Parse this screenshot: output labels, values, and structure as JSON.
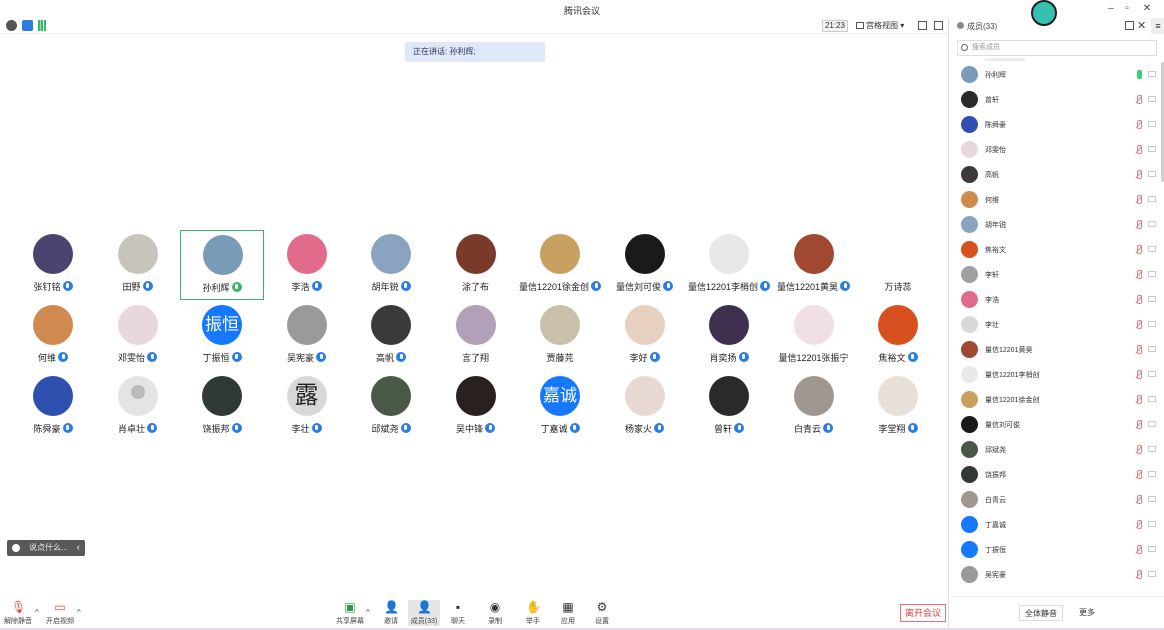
{
  "window": {
    "title": "腾讯会议"
  },
  "toolbar": {
    "clock": "21:23",
    "layout_label": "宫格视图",
    "layout_caret": "▾"
  },
  "speaking_banner": "正在讲话: 孙利辉;",
  "grid": [
    {
      "name": "张钉铭",
      "bg": "#4a4470",
      "mic": "blue"
    },
    {
      "name": "田野",
      "bg": "#c9c4bb",
      "mic": "blue"
    },
    {
      "name": "孙利辉",
      "bg": "#7a9bb8",
      "mic": "green",
      "active": true
    },
    {
      "name": "李浩",
      "bg": "#e06b8a",
      "mic": "blue"
    },
    {
      "name": "胡年锐",
      "bg": "#8aa4c0",
      "mic": "blue"
    },
    {
      "name": "涂了布",
      "bg": "#7a3a2a",
      "mic": "none"
    },
    {
      "name": "量信12201徐金创",
      "bg": "#c8a060",
      "mic": "blue"
    },
    {
      "name": "量信刘可俊",
      "bg": "#1a1a1a",
      "mic": "blue"
    },
    {
      "name": "量信12201李梢创",
      "bg": "#e8e8e8",
      "mic": "blue"
    },
    {
      "name": "量信12201黄昊",
      "bg": "#a04830",
      "mic": "blue"
    },
    {
      "name": "万诗蕊",
      "bg": "#ffffff",
      "mic": "none"
    },
    {
      "name": "何维",
      "bg": "#d08a50",
      "mic": "blue"
    },
    {
      "name": "邓雯怡",
      "bg": "#e8d8dc",
      "mic": "blue"
    },
    {
      "name": "丁振恒",
      "bg": "#1677ff",
      "text": "振恒",
      "mic": "blue"
    },
    {
      "name": "吴宪豪",
      "bg": "#9a9a9a",
      "mic": "blue"
    },
    {
      "name": "高帆",
      "bg": "#3a3a3a",
      "mic": "blue"
    },
    {
      "name": "言了翔",
      "bg": "#b0a0b8",
      "mic": "none"
    },
    {
      "name": "贾藤芫",
      "bg": "#c8c0a8",
      "mic": "none"
    },
    {
      "name": "李好",
      "bg": "#e8d0c0",
      "mic": "blue"
    },
    {
      "name": "肖奕扬",
      "bg": "#403050",
      "mic": "blue"
    },
    {
      "name": "量信12201张振宁",
      "bg": "#f0e0e4",
      "mic": "none"
    },
    {
      "name": "焦裕文",
      "bg": "#d85020",
      "mic": "blue"
    },
    {
      "name": "陈舜豪",
      "bg": "#3050b0",
      "mic": "blue"
    },
    {
      "name": "肖卓壮",
      "bg": "#e4e4e4",
      "mic": "blue",
      "placeholder": true
    },
    {
      "name": "饶振邦",
      "bg": "#303838",
      "mic": "blue"
    },
    {
      "name": "李壮",
      "bg": "#d8d8d8",
      "text": "露",
      "mic": "blue",
      "dark_text": true
    },
    {
      "name": "邱斌尧",
      "bg": "#4a5848",
      "mic": "blue"
    },
    {
      "name": "吴中锋",
      "bg": "#2a2020",
      "mic": "blue"
    },
    {
      "name": "丁嘉诚",
      "bg": "#1677ff",
      "text": "嘉诚",
      "mic": "blue"
    },
    {
      "name": "杨家火",
      "bg": "#e8d8d4",
      "mic": "blue"
    },
    {
      "name": "曾轩",
      "bg": "#2a2a2a",
      "mic": "blue"
    },
    {
      "name": "白青云",
      "bg": "#a09890",
      "mic": "blue"
    },
    {
      "name": "李堂翔",
      "bg": "#e8e0d8",
      "mic": "blue"
    }
  ],
  "chat": {
    "placeholder": "说点什么..."
  },
  "bottombar": {
    "mute": "解除静音",
    "video": "开启视频",
    "share": "共享屏幕",
    "invite": "邀请",
    "members": "成员(33)",
    "chat": "聊天",
    "record": "录制",
    "raise": "举手",
    "apps": "应用",
    "settings": "设置",
    "leave": "离开会议"
  },
  "panel": {
    "title": "成员(33)",
    "search_placeholder": "搜索成员",
    "members": [
      {
        "name": "孙利辉",
        "bg": "#7a9bb8",
        "mic_on": true
      },
      {
        "name": "曾轩",
        "bg": "#2a2a2a",
        "mic_on": false
      },
      {
        "name": "陈舜豪",
        "bg": "#3050b0",
        "mic_on": false
      },
      {
        "name": "邓雯怡",
        "bg": "#e8d8dc",
        "mic_on": false
      },
      {
        "name": "高帆",
        "bg": "#3a3a3a",
        "mic_on": false
      },
      {
        "name": "何维",
        "bg": "#d08a50",
        "mic_on": false
      },
      {
        "name": "胡年锐",
        "bg": "#8aa4c0",
        "mic_on": false
      },
      {
        "name": "焦裕文",
        "bg": "#d85020",
        "mic_on": false
      },
      {
        "name": "李轩",
        "bg": "#a0a0a0",
        "mic_on": false
      },
      {
        "name": "李浩",
        "bg": "#e06b8a",
        "mic_on": false
      },
      {
        "name": "李壮",
        "bg": "#d8d8d8",
        "mic_on": false
      },
      {
        "name": "量信12201黄昊",
        "bg": "#a04830",
        "mic_on": false
      },
      {
        "name": "量信12201李梢创",
        "bg": "#e8e8e8",
        "mic_on": false
      },
      {
        "name": "量信12201徐金创",
        "bg": "#c8a060",
        "mic_on": false
      },
      {
        "name": "量信刘可俊",
        "bg": "#1a1a1a",
        "mic_on": false
      },
      {
        "name": "邱斌尧",
        "bg": "#4a5848",
        "mic_on": false
      },
      {
        "name": "饶振邦",
        "bg": "#303838",
        "mic_on": false
      },
      {
        "name": "白青云",
        "bg": "#a09890",
        "mic_on": false
      },
      {
        "name": "丁嘉诚",
        "bg": "#1677ff",
        "mic_on": false
      },
      {
        "name": "丁振恒",
        "bg": "#1677ff",
        "mic_on": false
      },
      {
        "name": "吴宪豪",
        "bg": "#9a9a9a",
        "mic_on": false
      }
    ],
    "mute_all": "全体静音",
    "more": "更多"
  },
  "colors": {
    "accent": "#1677ff",
    "active_border": "#3bb56b",
    "leave": "#e04040"
  }
}
